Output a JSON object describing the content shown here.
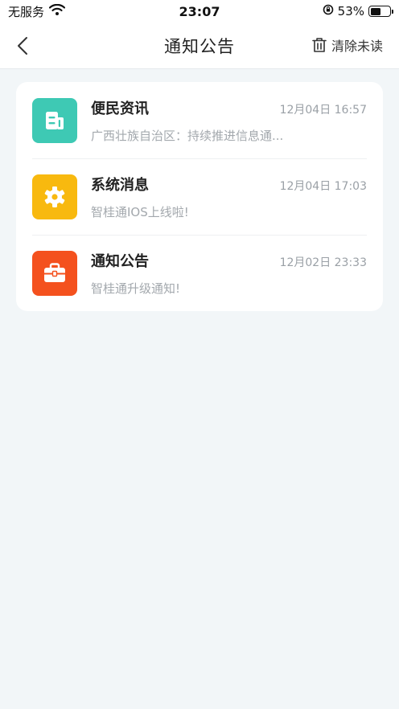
{
  "status_bar": {
    "carrier": "无服务",
    "time": "23:07",
    "battery_text": "53%",
    "battery_level": 0.53
  },
  "nav": {
    "title": "通知公告",
    "clear_label": "清除未读"
  },
  "messages": [
    {
      "title": "便民资讯",
      "time": "12月04日 16:57",
      "preview": "广西壮族自治区：持续推进信息通...",
      "icon": "news-icon",
      "color": "#3ec9b4"
    },
    {
      "title": "系统消息",
      "time": "12月04日 17:03",
      "preview": "智桂通IOS上线啦!",
      "icon": "gear-icon",
      "color": "#f8b90f"
    },
    {
      "title": "通知公告",
      "time": "12月02日 23:33",
      "preview": "智桂通升级通知!",
      "icon": "briefcase-icon",
      "color": "#f4511e"
    }
  ]
}
